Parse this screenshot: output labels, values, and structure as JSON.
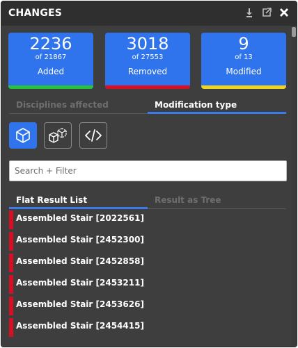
{
  "header": {
    "title": "CHANGES",
    "icons": [
      "download-icon",
      "popout-icon",
      "close-icon"
    ]
  },
  "stats": [
    {
      "value": "2236",
      "total_text": "of 21867",
      "label": "Added",
      "bar_color": "#27c23b"
    },
    {
      "value": "3018",
      "total_text": "of 27553",
      "label": "Removed",
      "bar_color": "#d80f22"
    },
    {
      "value": "9",
      "total_text": "of 13",
      "label": "Modified",
      "bar_color": "#efd51c"
    }
  ],
  "view_tabs": [
    {
      "label": "Disciplines affected",
      "active": false
    },
    {
      "label": "Modification type",
      "active": true
    }
  ],
  "filter_buttons": [
    {
      "icon": "cube-icon",
      "active": true
    },
    {
      "icon": "cube-change-icon",
      "active": false
    },
    {
      "icon": "code-icon",
      "active": false
    }
  ],
  "search": {
    "placeholder": "Search + Filter",
    "value": ""
  },
  "result_tabs": [
    {
      "label": "Flat Result List",
      "active": true
    },
    {
      "label": "Result as Tree",
      "active": false
    }
  ],
  "results": [
    "Assembled Stair [2022561]",
    "Assembled Stair [2452300]",
    "Assembled Stair [2452858]",
    "Assembled Stair [2453211]",
    "Assembled Stair [2453626]",
    "Assembled Stair [2454415]"
  ],
  "colors": {
    "accent": "#2f74ec",
    "added": "#27c23b",
    "removed": "#d80f22",
    "modified": "#efd51c"
  }
}
